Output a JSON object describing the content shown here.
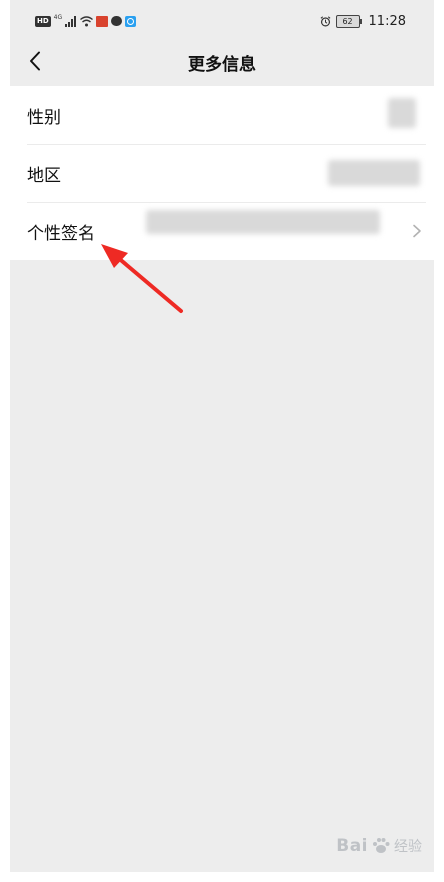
{
  "status_bar": {
    "hd": "HD",
    "network": "4G",
    "battery": "62",
    "time": "11:28",
    "icons": [
      "hd-badge",
      "signal-icon",
      "wifi-icon",
      "app-notification-icon",
      "message-icon",
      "search-app-icon",
      "alarm-icon",
      "battery-icon"
    ]
  },
  "nav": {
    "title": "更多信息",
    "back_icon": "chevron-left-icon"
  },
  "rows": [
    {
      "label": "性别"
    },
    {
      "label": "地区"
    },
    {
      "label": "个性签名",
      "chevron_icon": "chevron-right-icon"
    }
  ],
  "annotation": {
    "color": "#ee2a24"
  },
  "watermark": {
    "brand": "Bai",
    "suffix": "经验"
  },
  "colors": {
    "background": "#ededed",
    "card": "#ffffff",
    "annotation_red": "#ee2a24"
  }
}
